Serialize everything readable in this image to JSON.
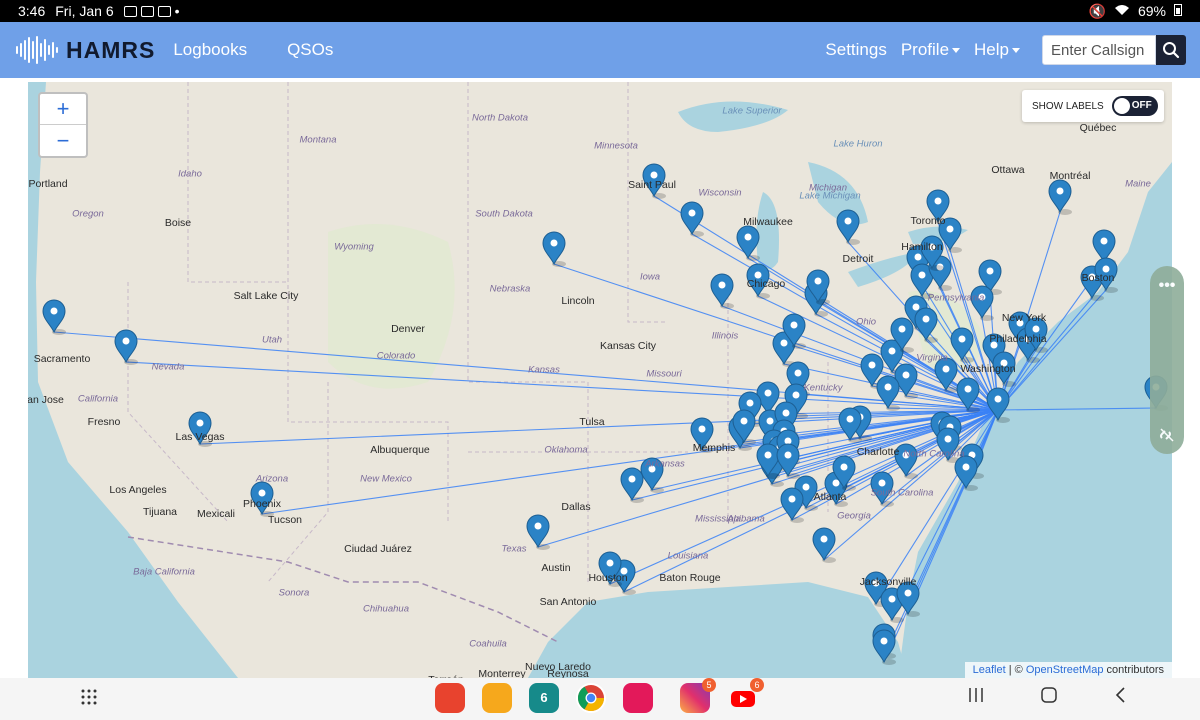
{
  "status_bar": {
    "time": "3:46",
    "date": "Fri, Jan 6",
    "battery": "69%"
  },
  "header": {
    "brand": "HAMRS",
    "nav": {
      "logbooks": "Logbooks",
      "qsos": "QSOs",
      "settings": "Settings",
      "profile": "Profile",
      "help": "Help"
    },
    "callsign_placeholder": "Enter Callsign"
  },
  "map": {
    "zoom_in": "+",
    "zoom_out": "−",
    "show_labels": "SHOW LABELS",
    "labels_state": "OFF",
    "attribution": {
      "leaflet": "Leaflet",
      "separator": " | © ",
      "osm": "OpenStreetMap",
      "suffix": " contributors"
    },
    "city_labels": [
      "Portland",
      "Boise",
      "Sacramento",
      "San Jose",
      "Fresno",
      "Las Vegas",
      "Los Angeles",
      "Tijuana",
      "Mexicali",
      "Phoenix",
      "Tucson",
      "Salt Lake City",
      "Denver",
      "Albuquerque",
      "Ciudad Juárez",
      "Kansas City",
      "Lincoln",
      "Tulsa",
      "Dallas",
      "Austin",
      "Houston",
      "San Antonio",
      "Nuevo Laredo",
      "Monterrey",
      "Reynosa",
      "Torreón",
      "Memphis",
      "Baton Rouge",
      "Saint Paul",
      "Milwaukee",
      "Chicago",
      "Detroit",
      "Hamilton",
      "Toronto",
      "Ottawa",
      "Montréal",
      "Québec",
      "Atlanta",
      "Charlotte",
      "Jacksonville",
      "Philadelphia",
      "New York",
      "Boston",
      "Washington"
    ],
    "region_labels": [
      "Montana",
      "Idaho",
      "Oregon",
      "Wyoming",
      "Nevada",
      "Utah",
      "Colorado",
      "California",
      "Arizona",
      "New Mexico",
      "Texas",
      "Oklahoma",
      "Kansas",
      "Nebraska",
      "South Dakota",
      "North Dakota",
      "Minnesota",
      "Wisconsin",
      "Michigan",
      "Iowa",
      "Illinois",
      "Missouri",
      "Kentucky",
      "Arkansas",
      "Mississippi",
      "Alabama",
      "Georgia",
      "Louisiana",
      "Ohio",
      "Pennsylvania",
      "Virginia",
      "North Carolina",
      "South Carolina",
      "Sonora",
      "Chihuahua",
      "Coahuila",
      "Baja California",
      "Maine",
      "Lake Superior",
      "Lake Huron",
      "Lake Michigan"
    ],
    "contact_count": 84,
    "home_station": "Virginia"
  },
  "edge_panel": {
    "menu": "•••"
  },
  "dock": {
    "badges": {
      "instagram": "5",
      "youtube": "6",
      "calendar": "6"
    }
  }
}
